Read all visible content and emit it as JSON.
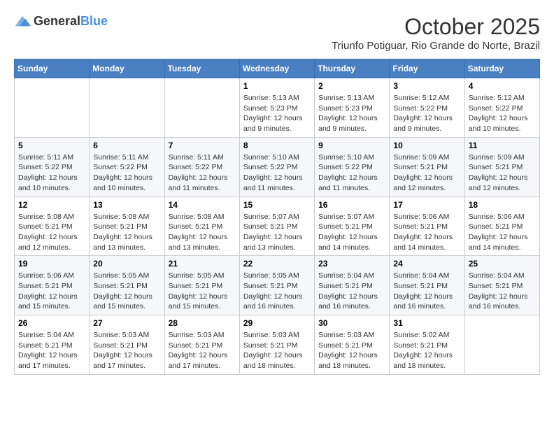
{
  "header": {
    "logo_general": "General",
    "logo_blue": "Blue",
    "month": "October 2025",
    "location": "Triunfo Potiguar, Rio Grande do Norte, Brazil"
  },
  "weekdays": [
    "Sunday",
    "Monday",
    "Tuesday",
    "Wednesday",
    "Thursday",
    "Friday",
    "Saturday"
  ],
  "weeks": [
    [
      {
        "day": "",
        "sunrise": "",
        "sunset": "",
        "daylight": ""
      },
      {
        "day": "",
        "sunrise": "",
        "sunset": "",
        "daylight": ""
      },
      {
        "day": "",
        "sunrise": "",
        "sunset": "",
        "daylight": ""
      },
      {
        "day": "1",
        "sunrise": "Sunrise: 5:13 AM",
        "sunset": "Sunset: 5:23 PM",
        "daylight": "Daylight: 12 hours and 9 minutes."
      },
      {
        "day": "2",
        "sunrise": "Sunrise: 5:13 AM",
        "sunset": "Sunset: 5:23 PM",
        "daylight": "Daylight: 12 hours and 9 minutes."
      },
      {
        "day": "3",
        "sunrise": "Sunrise: 5:12 AM",
        "sunset": "Sunset: 5:22 PM",
        "daylight": "Daylight: 12 hours and 9 minutes."
      },
      {
        "day": "4",
        "sunrise": "Sunrise: 5:12 AM",
        "sunset": "Sunset: 5:22 PM",
        "daylight": "Daylight: 12 hours and 10 minutes."
      }
    ],
    [
      {
        "day": "5",
        "sunrise": "Sunrise: 5:11 AM",
        "sunset": "Sunset: 5:22 PM",
        "daylight": "Daylight: 12 hours and 10 minutes."
      },
      {
        "day": "6",
        "sunrise": "Sunrise: 5:11 AM",
        "sunset": "Sunset: 5:22 PM",
        "daylight": "Daylight: 12 hours and 10 minutes."
      },
      {
        "day": "7",
        "sunrise": "Sunrise: 5:11 AM",
        "sunset": "Sunset: 5:22 PM",
        "daylight": "Daylight: 12 hours and 11 minutes."
      },
      {
        "day": "8",
        "sunrise": "Sunrise: 5:10 AM",
        "sunset": "Sunset: 5:22 PM",
        "daylight": "Daylight: 12 hours and 11 minutes."
      },
      {
        "day": "9",
        "sunrise": "Sunrise: 5:10 AM",
        "sunset": "Sunset: 5:22 PM",
        "daylight": "Daylight: 12 hours and 11 minutes."
      },
      {
        "day": "10",
        "sunrise": "Sunrise: 5:09 AM",
        "sunset": "Sunset: 5:21 PM",
        "daylight": "Daylight: 12 hours and 12 minutes."
      },
      {
        "day": "11",
        "sunrise": "Sunrise: 5:09 AM",
        "sunset": "Sunset: 5:21 PM",
        "daylight": "Daylight: 12 hours and 12 minutes."
      }
    ],
    [
      {
        "day": "12",
        "sunrise": "Sunrise: 5:08 AM",
        "sunset": "Sunset: 5:21 PM",
        "daylight": "Daylight: 12 hours and 12 minutes."
      },
      {
        "day": "13",
        "sunrise": "Sunrise: 5:08 AM",
        "sunset": "Sunset: 5:21 PM",
        "daylight": "Daylight: 12 hours and 13 minutes."
      },
      {
        "day": "14",
        "sunrise": "Sunrise: 5:08 AM",
        "sunset": "Sunset: 5:21 PM",
        "daylight": "Daylight: 12 hours and 13 minutes."
      },
      {
        "day": "15",
        "sunrise": "Sunrise: 5:07 AM",
        "sunset": "Sunset: 5:21 PM",
        "daylight": "Daylight: 12 hours and 13 minutes."
      },
      {
        "day": "16",
        "sunrise": "Sunrise: 5:07 AM",
        "sunset": "Sunset: 5:21 PM",
        "daylight": "Daylight: 12 hours and 14 minutes."
      },
      {
        "day": "17",
        "sunrise": "Sunrise: 5:06 AM",
        "sunset": "Sunset: 5:21 PM",
        "daylight": "Daylight: 12 hours and 14 minutes."
      },
      {
        "day": "18",
        "sunrise": "Sunrise: 5:06 AM",
        "sunset": "Sunset: 5:21 PM",
        "daylight": "Daylight: 12 hours and 14 minutes."
      }
    ],
    [
      {
        "day": "19",
        "sunrise": "Sunrise: 5:06 AM",
        "sunset": "Sunset: 5:21 PM",
        "daylight": "Daylight: 12 hours and 15 minutes."
      },
      {
        "day": "20",
        "sunrise": "Sunrise: 5:05 AM",
        "sunset": "Sunset: 5:21 PM",
        "daylight": "Daylight: 12 hours and 15 minutes."
      },
      {
        "day": "21",
        "sunrise": "Sunrise: 5:05 AM",
        "sunset": "Sunset: 5:21 PM",
        "daylight": "Daylight: 12 hours and 15 minutes."
      },
      {
        "day": "22",
        "sunrise": "Sunrise: 5:05 AM",
        "sunset": "Sunset: 5:21 PM",
        "daylight": "Daylight: 12 hours and 16 minutes."
      },
      {
        "day": "23",
        "sunrise": "Sunrise: 5:04 AM",
        "sunset": "Sunset: 5:21 PM",
        "daylight": "Daylight: 12 hours and 16 minutes."
      },
      {
        "day": "24",
        "sunrise": "Sunrise: 5:04 AM",
        "sunset": "Sunset: 5:21 PM",
        "daylight": "Daylight: 12 hours and 16 minutes."
      },
      {
        "day": "25",
        "sunrise": "Sunrise: 5:04 AM",
        "sunset": "Sunset: 5:21 PM",
        "daylight": "Daylight: 12 hours and 16 minutes."
      }
    ],
    [
      {
        "day": "26",
        "sunrise": "Sunrise: 5:04 AM",
        "sunset": "Sunset: 5:21 PM",
        "daylight": "Daylight: 12 hours and 17 minutes."
      },
      {
        "day": "27",
        "sunrise": "Sunrise: 5:03 AM",
        "sunset": "Sunset: 5:21 PM",
        "daylight": "Daylight: 12 hours and 17 minutes."
      },
      {
        "day": "28",
        "sunrise": "Sunrise: 5:03 AM",
        "sunset": "Sunset: 5:21 PM",
        "daylight": "Daylight: 12 hours and 17 minutes."
      },
      {
        "day": "29",
        "sunrise": "Sunrise: 5:03 AM",
        "sunset": "Sunset: 5:21 PM",
        "daylight": "Daylight: 12 hours and 18 minutes."
      },
      {
        "day": "30",
        "sunrise": "Sunrise: 5:03 AM",
        "sunset": "Sunset: 5:21 PM",
        "daylight": "Daylight: 12 hours and 18 minutes."
      },
      {
        "day": "31",
        "sunrise": "Sunrise: 5:02 AM",
        "sunset": "Sunset: 5:21 PM",
        "daylight": "Daylight: 12 hours and 18 minutes."
      },
      {
        "day": "",
        "sunrise": "",
        "sunset": "",
        "daylight": ""
      }
    ]
  ]
}
